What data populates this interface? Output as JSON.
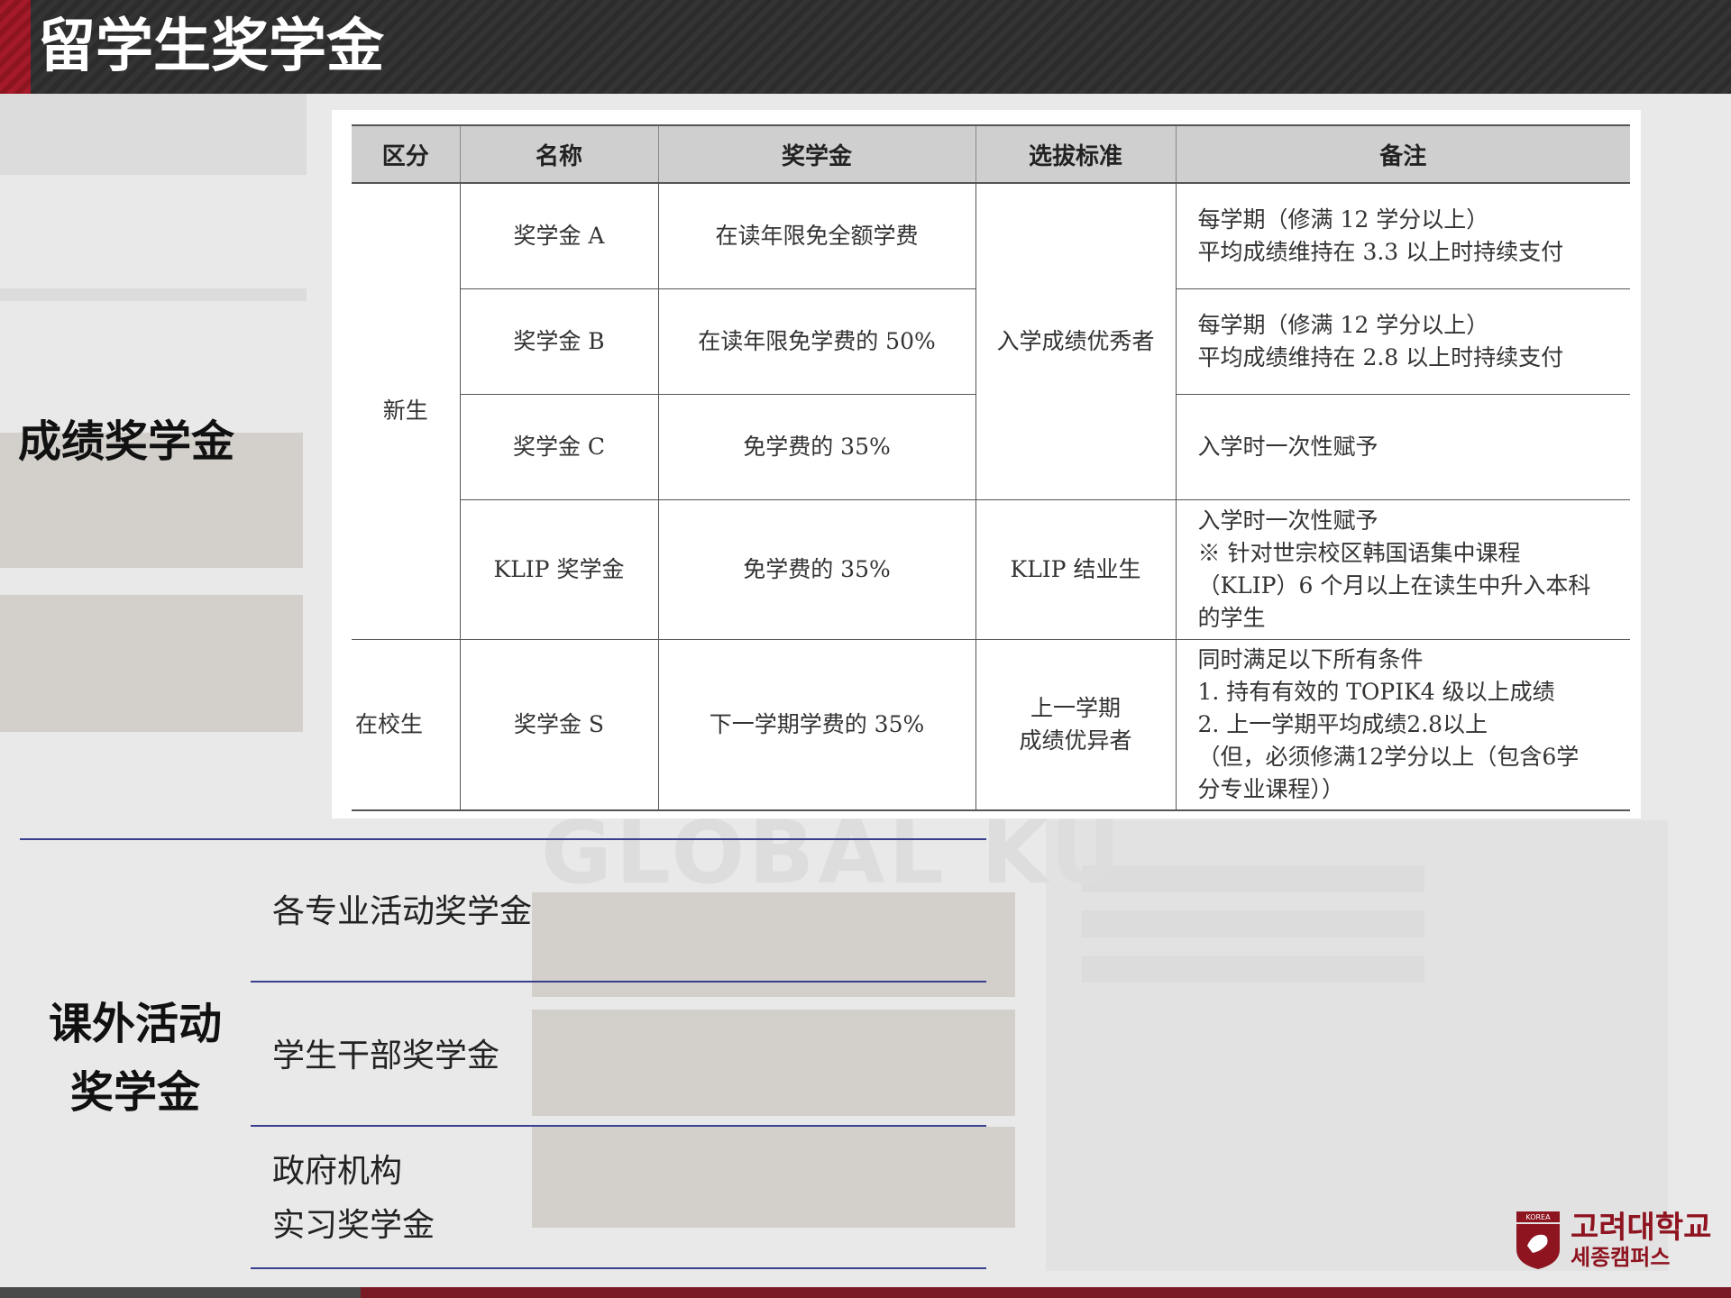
{
  "page": {
    "title": "留学生奖学金"
  },
  "table": {
    "headers": [
      "区分",
      "名称",
      "奖学金",
      "选拔标准",
      "备注"
    ],
    "rows": {
      "new_student_category": "新生",
      "enrolled_category": "在校生",
      "a": {
        "name": "奖学金 A",
        "amount": "在读年限免全额学费",
        "notes": [
          "每学期（修满 12 学分以上）",
          "平均成绩维持在 3.3 以上时持续支付"
        ]
      },
      "b": {
        "name": "奖学金 B",
        "amount": "在读年限免学费的 50%",
        "notes": [
          "每学期（修满 12 学分以上）",
          "平均成绩维持在 2.8 以上时持续支付"
        ]
      },
      "abc_criteria": "入学成绩优秀者",
      "c": {
        "name": "奖学金 C",
        "amount": "免学费的 35%",
        "notes": [
          "入学时一次性赋予"
        ]
      },
      "klip": {
        "name": "KLIP 奖学金",
        "amount": "免学费的 35%",
        "criteria": "KLIP 结业生",
        "notes": [
          "入学时一次性赋予",
          "※ 针对世宗校区韩国语集中课程",
          "（KLIP）6 个月以上在读生中升入本科",
          "的学生"
        ]
      },
      "s": {
        "name": "奖学金 S",
        "amount": "下一学期学费的 35%",
        "criteria_lines": [
          "上一学期",
          "成绩优异者"
        ],
        "notes": [
          "同时满足以下所有条件",
          "1. 持有有效的 TOPIK4 级以上成绩",
          "2. 上一学期平均成绩2.8以上",
          "（但，必须修满12学分以上（包含6学",
          "分专业课程））"
        ]
      }
    }
  },
  "sections": {
    "academic_label": "成绩奖学金",
    "extra_label_lines": [
      "课外活动",
      "奖学金"
    ],
    "extra_items": {
      "major_activity": "各专业活动奖学金",
      "student_cadre": "学生干部奖学金",
      "gov_intern_lines": [
        "政府机构",
        "实习奖学金"
      ]
    }
  },
  "logo": {
    "line1": "고려대학교",
    "line2": "세종캠퍼스",
    "emblem_text": "KOREA"
  },
  "background": {
    "watermark": "GLOBAL KU"
  },
  "colors": {
    "header": "#2c2c2c",
    "accent": "#8e1420",
    "rule": "#3a3f8f",
    "table_header": "#cfcfcf"
  }
}
